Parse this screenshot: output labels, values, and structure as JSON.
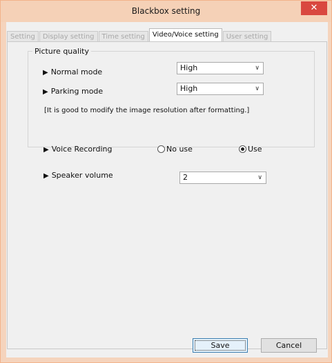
{
  "window": {
    "title": "Blackbox setting",
    "close_glyph": "✕"
  },
  "tabs": [
    {
      "label": "Setting",
      "active": false
    },
    {
      "label": "Display setting",
      "active": false
    },
    {
      "label": "Time setting",
      "active": false
    },
    {
      "label": "Video/Voice setting",
      "active": true
    },
    {
      "label": "User setting",
      "active": false
    }
  ],
  "picture_quality": {
    "group_label": "Picture quality",
    "normal_mode": {
      "label": "Normal mode",
      "value": "High"
    },
    "parking_mode": {
      "label": "Parking mode",
      "value": "High"
    },
    "note": "[It is good to modify the image resolution after formatting.]"
  },
  "voice_recording": {
    "label": "Voice Recording",
    "options": [
      {
        "label": "No use",
        "selected": false
      },
      {
        "label": "Use",
        "selected": true
      }
    ]
  },
  "speaker_volume": {
    "label": "Speaker volume",
    "value": "2"
  },
  "buttons": {
    "save": "Save",
    "cancel": "Cancel"
  },
  "icons": {
    "bullet": "▶",
    "dropdown": "∨"
  },
  "colors": {
    "titlebar": "#f5d1b7",
    "close_button": "#d9473f",
    "panel": "#f0f0f0"
  }
}
